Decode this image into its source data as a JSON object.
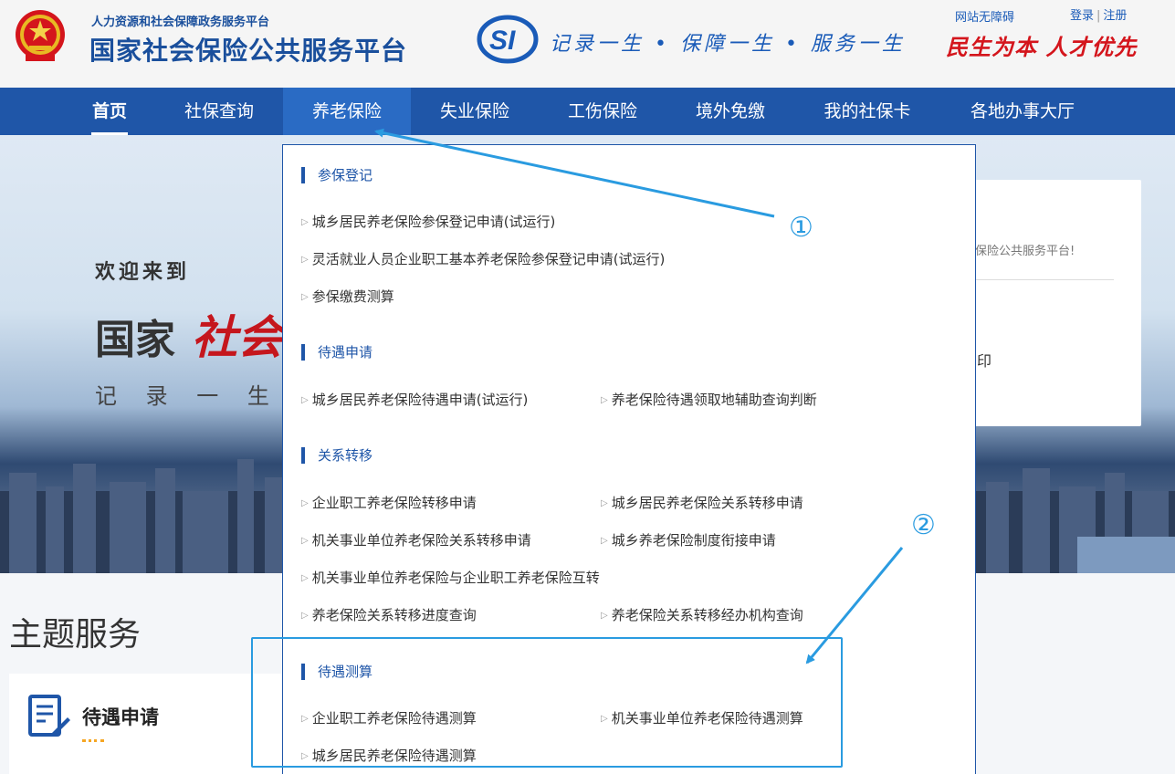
{
  "header": {
    "subtitle": "人力资源和社会保障政务服务平台",
    "title": "国家社会保险公共服务平台",
    "slogan": "记录一生 • 保障一生 • 服务一生",
    "accessibility": "网站无障碍",
    "login": "登录",
    "separator": "|",
    "register": "注册",
    "red_slogan": "民生为本 人才优先",
    "colors": {
      "brand": "#1f56a8",
      "red": "#d4151c"
    }
  },
  "nav": {
    "items": [
      {
        "label": "首页"
      },
      {
        "label": "社保查询"
      },
      {
        "label": "养老保险"
      },
      {
        "label": "失业保险"
      },
      {
        "label": "工伤保险"
      },
      {
        "label": "境外免缴"
      },
      {
        "label": "我的社保卡"
      },
      {
        "label": "各地办事大厅"
      }
    ]
  },
  "banner": {
    "welcome": "欢迎来到",
    "title_prefix": "国家",
    "title_highlight": "社会",
    "slogan": "记 录 一 生 • 保"
  },
  "login_card": {
    "welcome_text": "保险公共服务平台!",
    "print_text": "印"
  },
  "theme": {
    "title": "主题服务",
    "card_label": "待遇申请"
  },
  "dropdown": {
    "sections": [
      {
        "title": "参保登记",
        "links": [
          "城乡居民养老保险参保登记申请(试运行)",
          "灵活就业人员企业职工基本养老保险参保登记申请(试运行)",
          "参保缴费测算"
        ]
      },
      {
        "title": "待遇申请",
        "links": [
          "城乡居民养老保险待遇申请(试运行)",
          "养老保险待遇领取地辅助查询判断"
        ]
      },
      {
        "title": "关系转移",
        "links": [
          "企业职工养老保险转移申请",
          "城乡居民养老保险关系转移申请",
          "机关事业单位养老保险关系转移申请",
          "城乡养老保险制度衔接申请",
          "机关事业单位养老保险与企业职工养老保险互转",
          "养老保险关系转移进度查询",
          "养老保险关系转移经办机构查询"
        ]
      },
      {
        "title": "待遇测算",
        "links": [
          "企业职工养老保险待遇测算",
          "机关事业单位养老保险待遇测算",
          "城乡居民养老保险待遇测算"
        ]
      }
    ]
  },
  "annotations": {
    "marker1": "①",
    "marker2": "②",
    "color": "#2a9be0"
  }
}
